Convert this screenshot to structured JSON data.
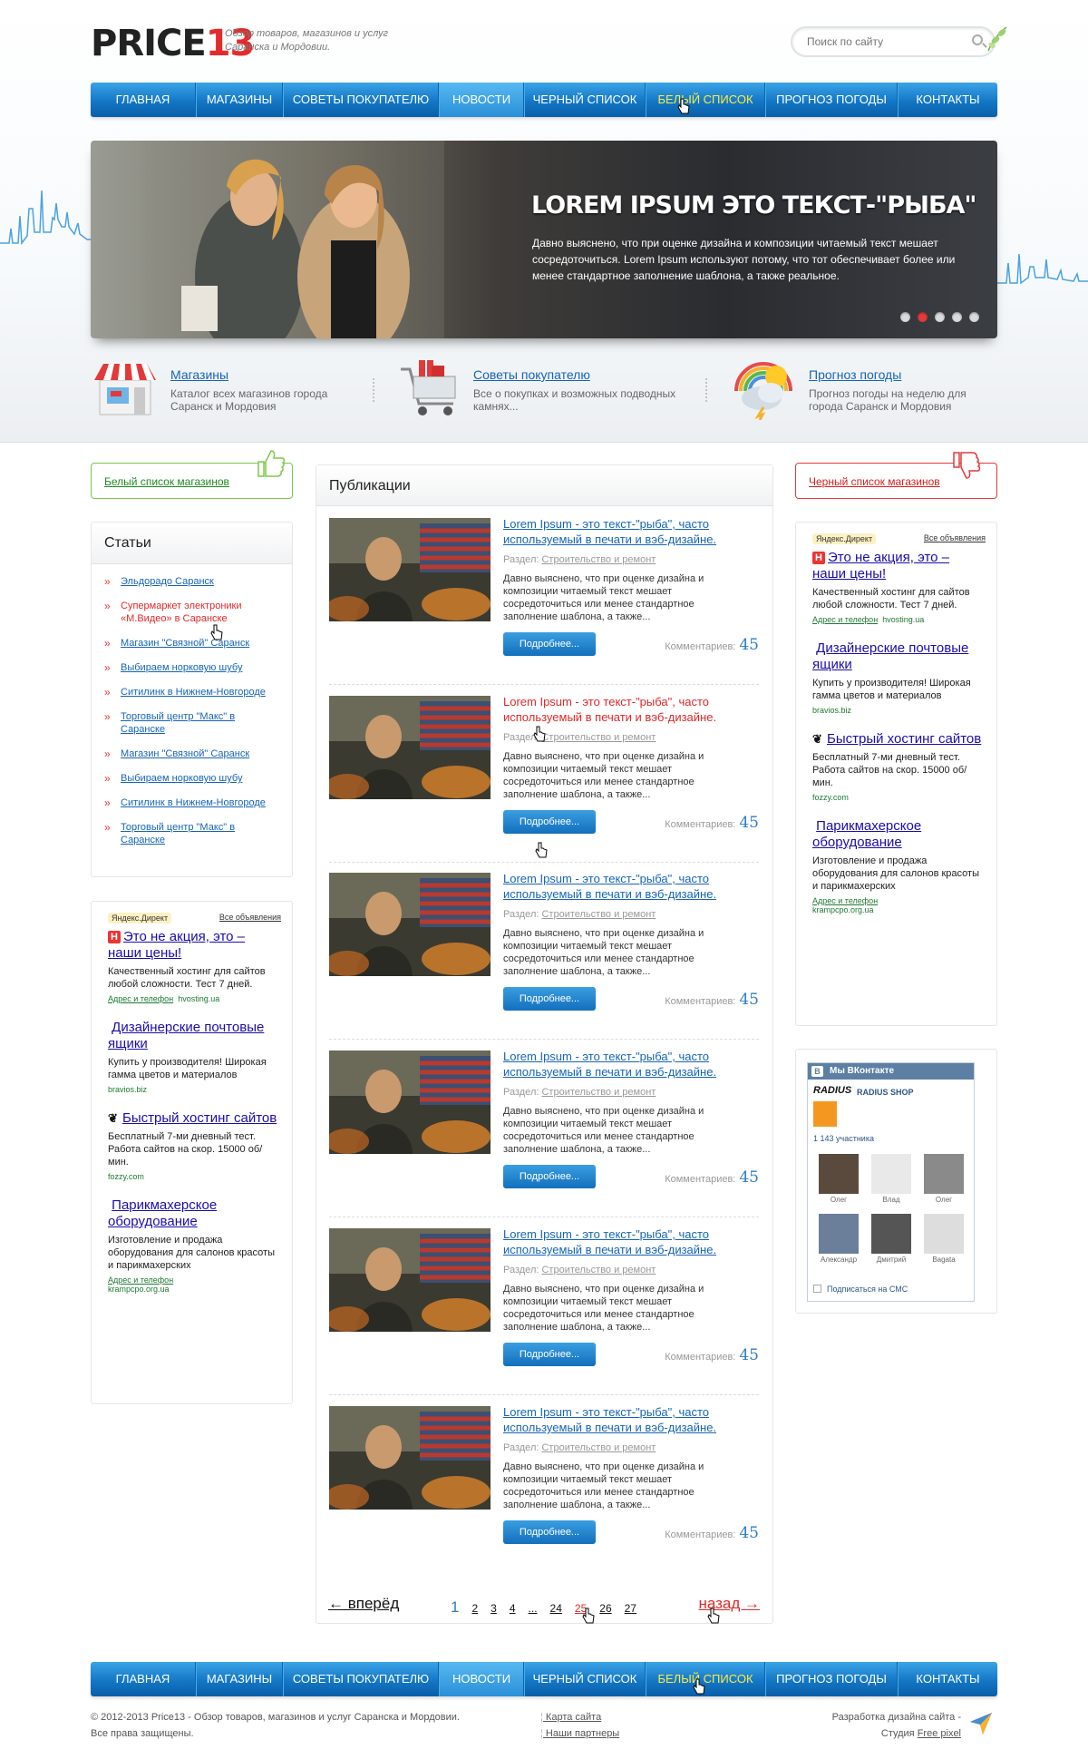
{
  "header": {
    "logo_left": "PRICE",
    "logo_right": "13",
    "tagline": "Обзор товаров, магазинов и услуг Саранска и Мордовии.",
    "search_placeholder": "Поиск по сайту"
  },
  "nav": {
    "items": [
      {
        "label": "ГЛАВНАЯ"
      },
      {
        "label": "МАГАЗИНЫ"
      },
      {
        "label": "СОВЕТЫ ПОКУПАТЕЛЮ"
      },
      {
        "label": "НОВОСТИ"
      },
      {
        "label": "ЧЕРНЫЙ СПИСОК"
      },
      {
        "label": "БЕЛЫЙ СПИСОК"
      },
      {
        "label": "ПРОГНОЗ ПОГОДЫ"
      },
      {
        "label": "КОНТАКТЫ"
      }
    ]
  },
  "slider": {
    "title": "LOREM IPSUM ЭТО ТЕКСТ-\"РЫБА\"",
    "text": "Давно выяснено, что при оценке дизайна и композиции читаемый текст мешает сосредоточиться. Lorem Ipsum используют потому, что тот обеспечивает более или менее стандартное заполнение шаблона, а также реальное."
  },
  "features": [
    {
      "title": "Магазины",
      "text": "Каталог всех магазинов города Саранск и Мордовия"
    },
    {
      "title": "Советы покупателю",
      "text": "Все о покупках и возможных подводных камнях..."
    },
    {
      "title": "Прогноз погоды",
      "text": "Прогноз погоды на неделю для города Саранск и Мордовия"
    }
  ],
  "white_list": "Белый список магазинов",
  "black_list": "Черный список магазинов",
  "articles": {
    "title": "Статьи",
    "items": [
      "Эльдорадо Саранск",
      "Супермаркет электроники «М.Видео» в Саранске",
      "Магазин \"Связной\" Саранск",
      "Выбираем норковую шубу",
      "Ситилинк в Нижнем-Новгороде",
      "Торговый центр \"Макс\" в Саранске",
      "Магазин \"Связной\" Саранск",
      "Выбираем норковую шубу",
      "Ситилинк в Нижнем-Новгороде",
      "Торговый центр \"Макс\" в Саранске"
    ]
  },
  "publications": {
    "title": "Публикации",
    "item_title": "Lorem Ipsum - это текст-\"рыба\", часто используемый в печати и вэб-дизайне.",
    "section_label": "Раздел:",
    "section_link": "Строительство и ремонт",
    "text": "Давно выяснено, что при оценке дизайна и композиции читаемый текст мешает сосредоточиться или менее стандартное заполнение шаблона, а также...",
    "more": "Подробнее...",
    "comments_label": "Комментариев:",
    "comments_count": "45"
  },
  "pager": {
    "prev": "← вперёд",
    "next": "назад →",
    "pages": [
      "1",
      "2",
      "3",
      "4",
      "...",
      "24",
      "25",
      "26",
      "27"
    ]
  },
  "ads": {
    "yandex": "Яндекс.Директ",
    "all": "Все объявления",
    "items": [
      {
        "title": "Это не акция, это – наши цены!",
        "text": "Качественный хостинг для сайтов любой сложности. Тест 7 дней.",
        "url_label": "Адрес и телефон",
        "url": "hvosting.ua"
      },
      {
        "title": "Дизайнерские почтовые ящики",
        "text": "Купить у производителя! Широкая гамма цветов и материалов",
        "url": "bravios.biz"
      },
      {
        "title": "Быстрый хостинг сайтов",
        "text": "Бесплатный 7-ми дневный тест. Работа сайтов на скор. 15000 об/мин.",
        "url": "fozzy.com"
      },
      {
        "title": "Парикмахерское оборудование",
        "text": "Изготовление и продажа оборудования для салонов красоты и парикмахерских",
        "url_label": "Адрес и телефон",
        "url": "krampcpo.org.ua"
      }
    ]
  },
  "vk": {
    "header": "Мы ВКонтакте",
    "brand": "RADIUS",
    "shop": "RADIUS SHOP",
    "count": "1 143 участника",
    "members": [
      "Олег",
      "Влад",
      "Олег",
      "Александр",
      "Дмитрий",
      "Bagata"
    ],
    "subscribe": "Подписаться на СМС"
  },
  "footer": {
    "copy1": "© 2012-2013 Price13 - Обзор товаров, магазинов и услуг Саранска и Мордовии.",
    "copy2": "Все права защищены.",
    "link1": "Карта сайта",
    "link2": "Наши партнеры",
    "dev1": "Разработка дизайна сайта -",
    "dev2": "Студия",
    "dev_link": "Free pixel"
  },
  "colors": {
    "accent": "#1377c6",
    "red": "#e02828",
    "green": "#7ac84c"
  }
}
